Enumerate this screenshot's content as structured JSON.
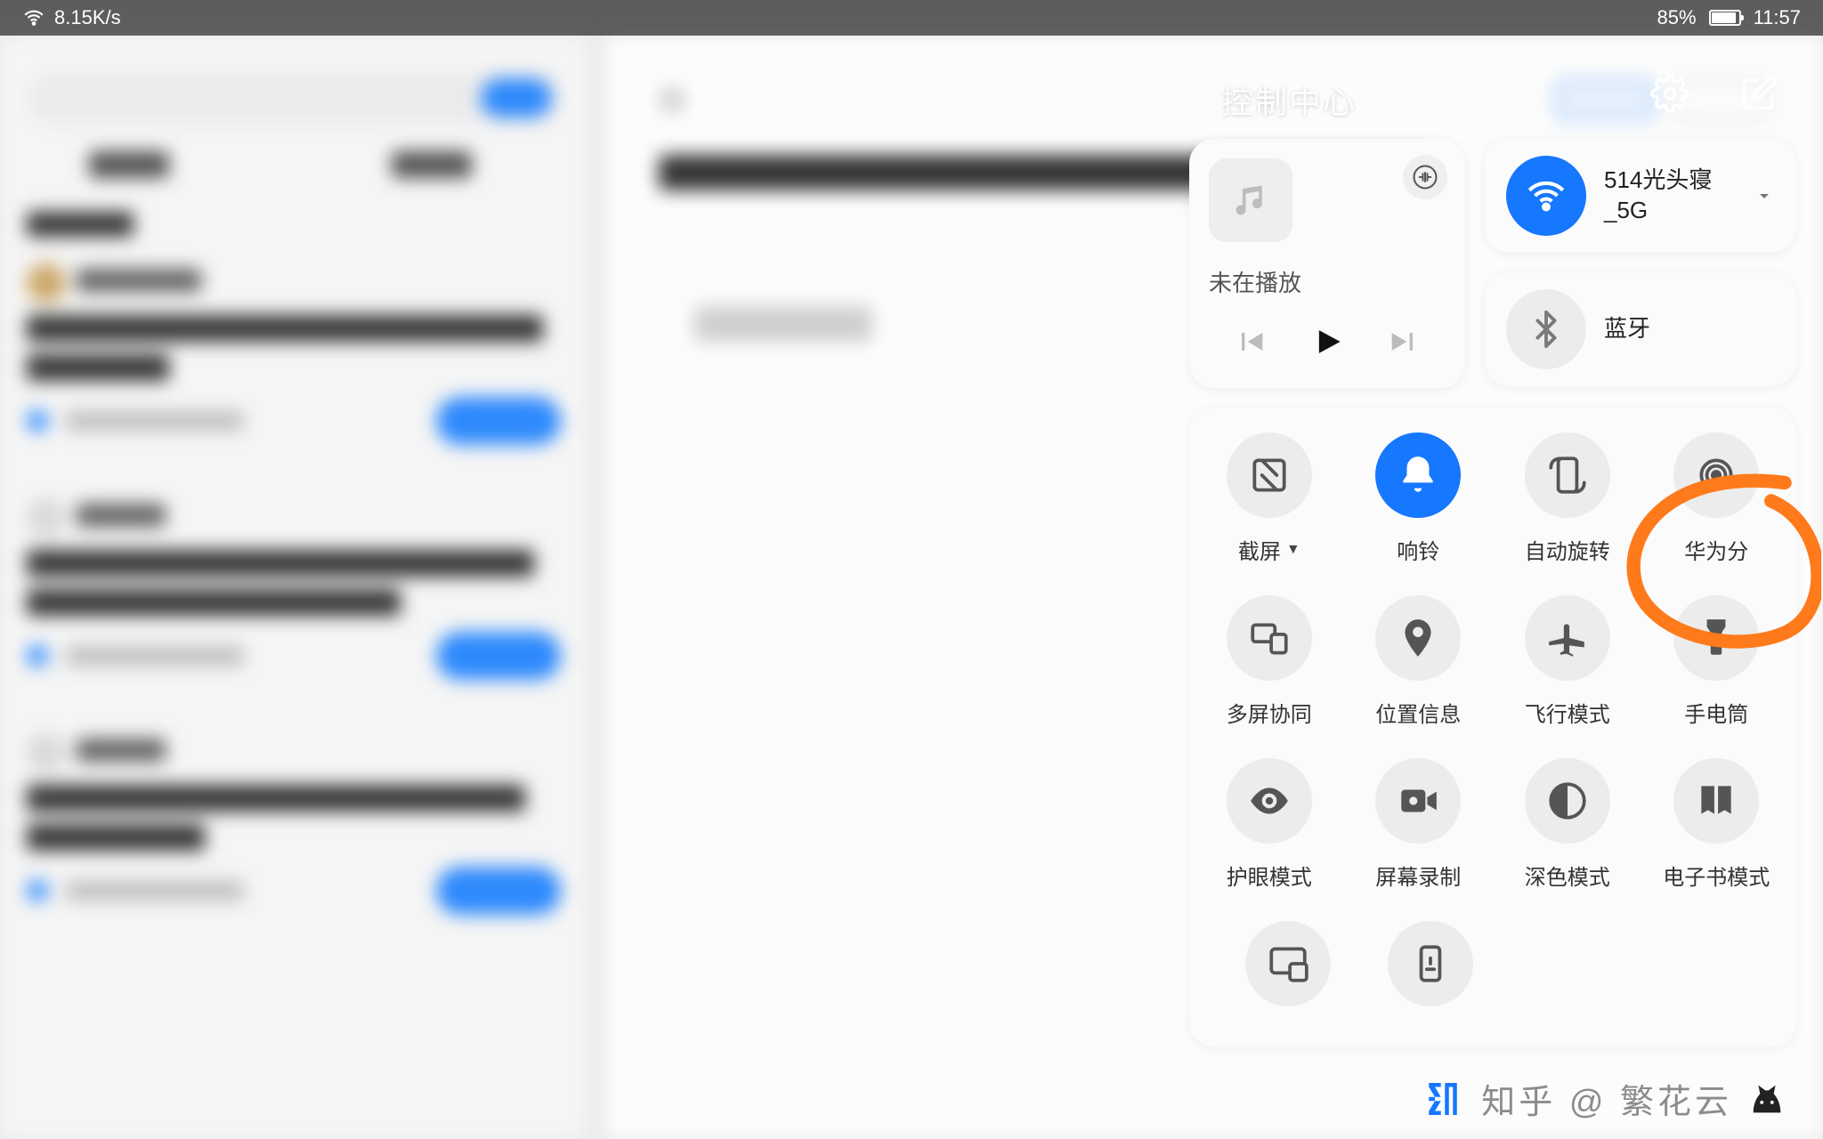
{
  "statusbar": {
    "net_speed": "8.15K/s",
    "battery_pct": "85%",
    "time": "11:57"
  },
  "control_center": {
    "title": "控制中心",
    "media": {
      "status": "未在播放"
    },
    "wifi": {
      "name": "514光头寝_5G",
      "on": true
    },
    "bluetooth": {
      "name": "蓝牙",
      "on": false
    },
    "toggles": [
      {
        "id": "screenshot",
        "label": "截屏",
        "has_caret": true,
        "on": false
      },
      {
        "id": "ringer",
        "label": "响铃",
        "has_caret": false,
        "on": true
      },
      {
        "id": "auto-rotate",
        "label": "自动旋转",
        "has_caret": false,
        "on": false
      },
      {
        "id": "hotspot",
        "label": "华为分",
        "has_caret": false,
        "on": false
      },
      {
        "id": "multi-screen",
        "label": "多屏协同",
        "has_caret": false,
        "on": false
      },
      {
        "id": "location",
        "label": "位置信息",
        "has_caret": false,
        "on": false
      },
      {
        "id": "airplane",
        "label": "飞行模式",
        "has_caret": false,
        "on": false
      },
      {
        "id": "flashlight",
        "label": "手电筒",
        "has_caret": false,
        "on": false
      },
      {
        "id": "eye-comfort",
        "label": "护眼模式",
        "has_caret": false,
        "on": false
      },
      {
        "id": "screen-record",
        "label": "屏幕录制",
        "has_caret": false,
        "on": false
      },
      {
        "id": "dark-mode",
        "label": "深色模式",
        "has_caret": false,
        "on": false
      },
      {
        "id": "ebook-mode",
        "label": "电子书模式",
        "has_caret": false,
        "on": false
      }
    ]
  },
  "watermark": {
    "text": "知乎 @ 繁花云"
  }
}
